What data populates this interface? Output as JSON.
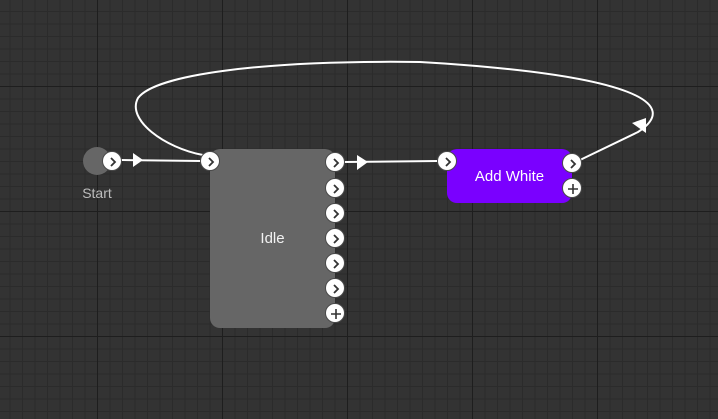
{
  "start": {
    "label": "Start"
  },
  "nodes": [
    {
      "id": "idle",
      "label": "Idle",
      "output_ports": 7,
      "color": "#666666"
    },
    {
      "id": "add-white",
      "label": "Add White",
      "output_ports": 1,
      "color": "#7a00ff"
    }
  ],
  "connections": [
    {
      "from": "start",
      "to": "idle"
    },
    {
      "from": "idle",
      "to": "add-white"
    },
    {
      "from": "add-white",
      "to": "idle"
    }
  ],
  "icons": {
    "port": "chevron-right-icon",
    "add_port": "plus-icon",
    "arrow": "arrowhead-icon"
  },
  "colors": {
    "background": "#333333",
    "wire": "#ffffff",
    "accent": "#7a00ff"
  }
}
